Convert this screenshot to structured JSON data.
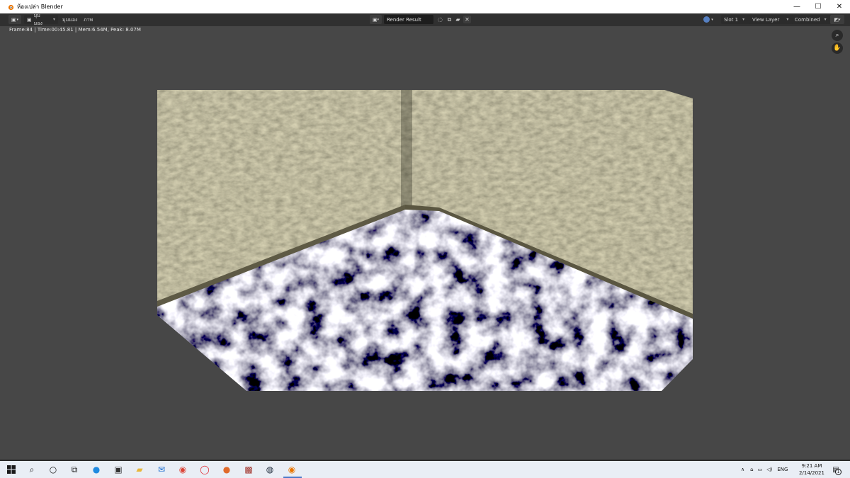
{
  "window": {
    "title": "ห้องเปล่า Blender",
    "minimize_glyph": "—",
    "maximize_glyph": "☐",
    "close_glyph": "✕"
  },
  "header": {
    "view_menu": "มุมมอง",
    "view_label": "มุมมอง",
    "image_label": "ภาพ",
    "image_name": "Render Result",
    "slot": "Slot 1",
    "view_layer": "View Layer",
    "pass": "Combined"
  },
  "editor": {
    "stats": "Frame:84 | Time:00:45.81 | Mem:6.54M, Peak: 8.07M"
  },
  "taskbar": {
    "language": "ENG",
    "time": "9:21 AM",
    "date": "2/14/2021",
    "notification_count": "1"
  },
  "colors": {
    "editor_bg": "#474747",
    "header_bg": "#303030",
    "wall": "#8c8566",
    "floor_light": "#b9b6c2",
    "floor_dark": "#1f1d33",
    "taskbar_bg": "#e9eef5"
  }
}
